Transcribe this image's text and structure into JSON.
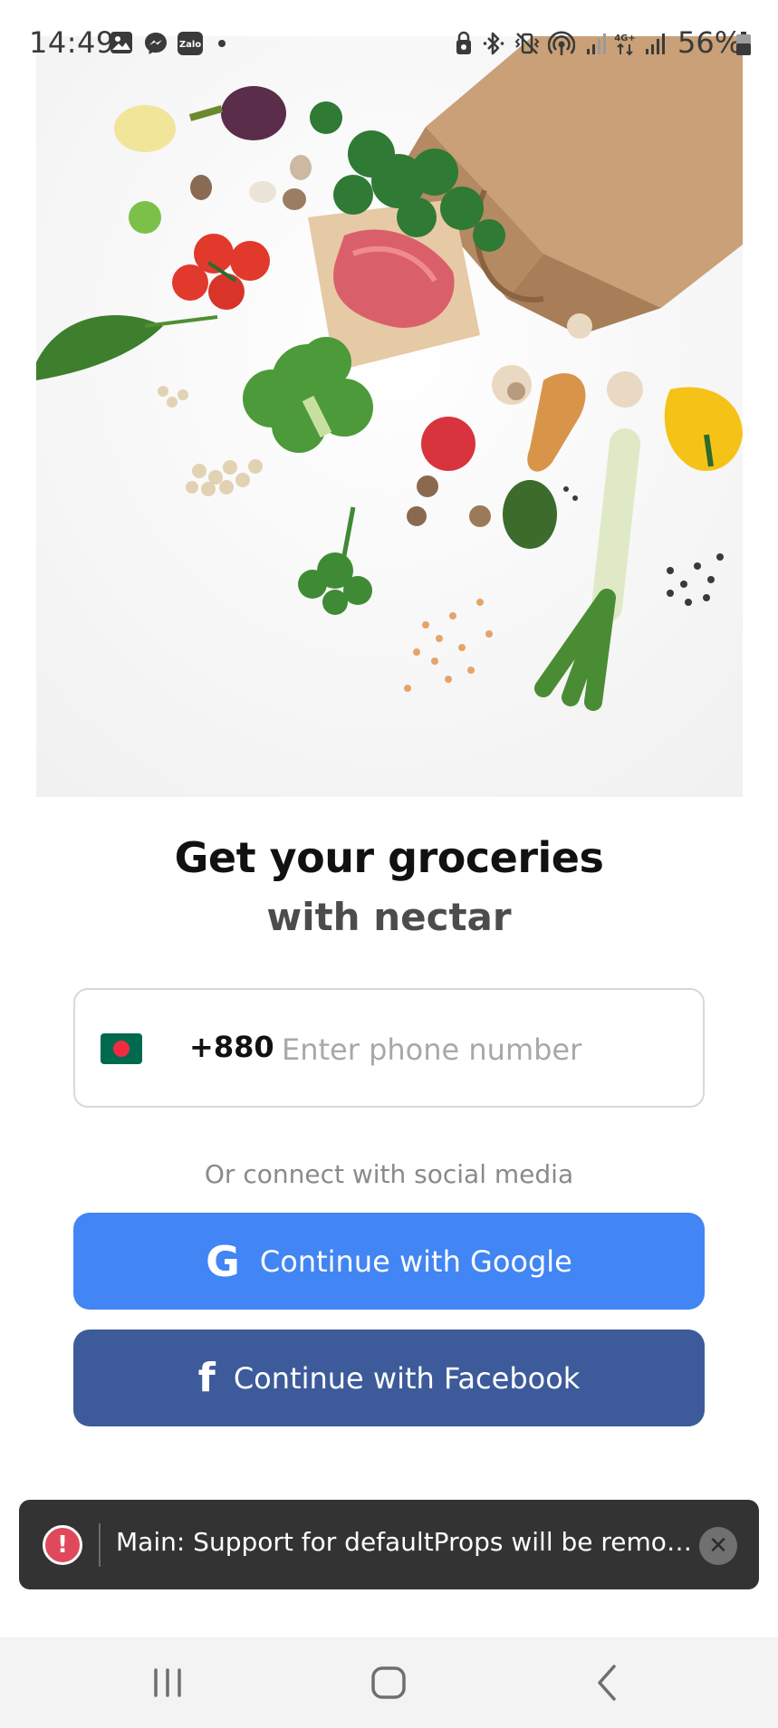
{
  "status_bar": {
    "time": "14:49",
    "battery": "56%",
    "left_icons": [
      "gallery-icon",
      "messenger-icon",
      "zalo-icon",
      "dot-icon"
    ],
    "right_icons": [
      "lock-icon",
      "bluetooth-icon",
      "vibrate-icon",
      "hotspot-icon",
      "signal-icon",
      "4g-icon",
      "signal-icon",
      "battery-icon"
    ],
    "zalo_label": "Zalo"
  },
  "hero": {
    "image": "groceries-bag-illustration"
  },
  "onboarding": {
    "title": "Get your groceries",
    "subtitle": "with nectar"
  },
  "phone": {
    "country_flag": "bangladesh-flag-icon",
    "dial_code": "+880",
    "placeholder": "Enter phone number",
    "value": ""
  },
  "social": {
    "divider_text": "Or connect with social media",
    "google_label": "Continue with Google",
    "google_icon_glyph": "G",
    "facebook_label": "Continue with Facebook",
    "facebook_icon_glyph": "f",
    "google_color": "#4285f4",
    "facebook_color": "#3d5b9a"
  },
  "toast": {
    "icon_glyph": "!",
    "message": "Main: Support for defaultProps will be remove...",
    "close_glyph": "✕",
    "icon_color": "#e0495c"
  },
  "nav_bar": {
    "recents": "recents-icon",
    "home": "home-icon",
    "back": "back-icon"
  }
}
